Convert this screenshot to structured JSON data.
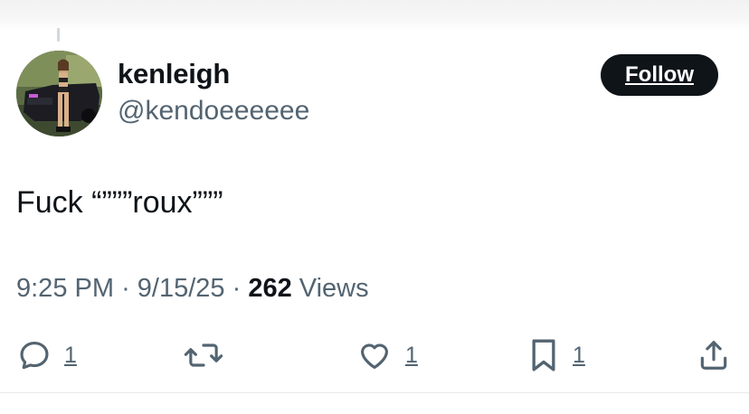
{
  "user": {
    "display_name": "kenleigh",
    "handle": "@kendoeeeeee"
  },
  "follow_label": "Follow",
  "tweet": {
    "text": "Fuck “”””roux”””",
    "time": "9:25 PM",
    "date": "9/15/25",
    "views_count": "262",
    "views_label": "Views"
  },
  "actions": {
    "reply_count": "1",
    "like_count": "1",
    "bookmark_count": "1"
  },
  "icons": [
    "reply-icon",
    "retweet-icon",
    "like-icon",
    "bookmark-icon",
    "share-icon"
  ],
  "colors": {
    "text_primary": "#0f1419",
    "text_secondary": "#536471",
    "follow_bg": "#0f1419",
    "follow_text": "#ffffff"
  }
}
